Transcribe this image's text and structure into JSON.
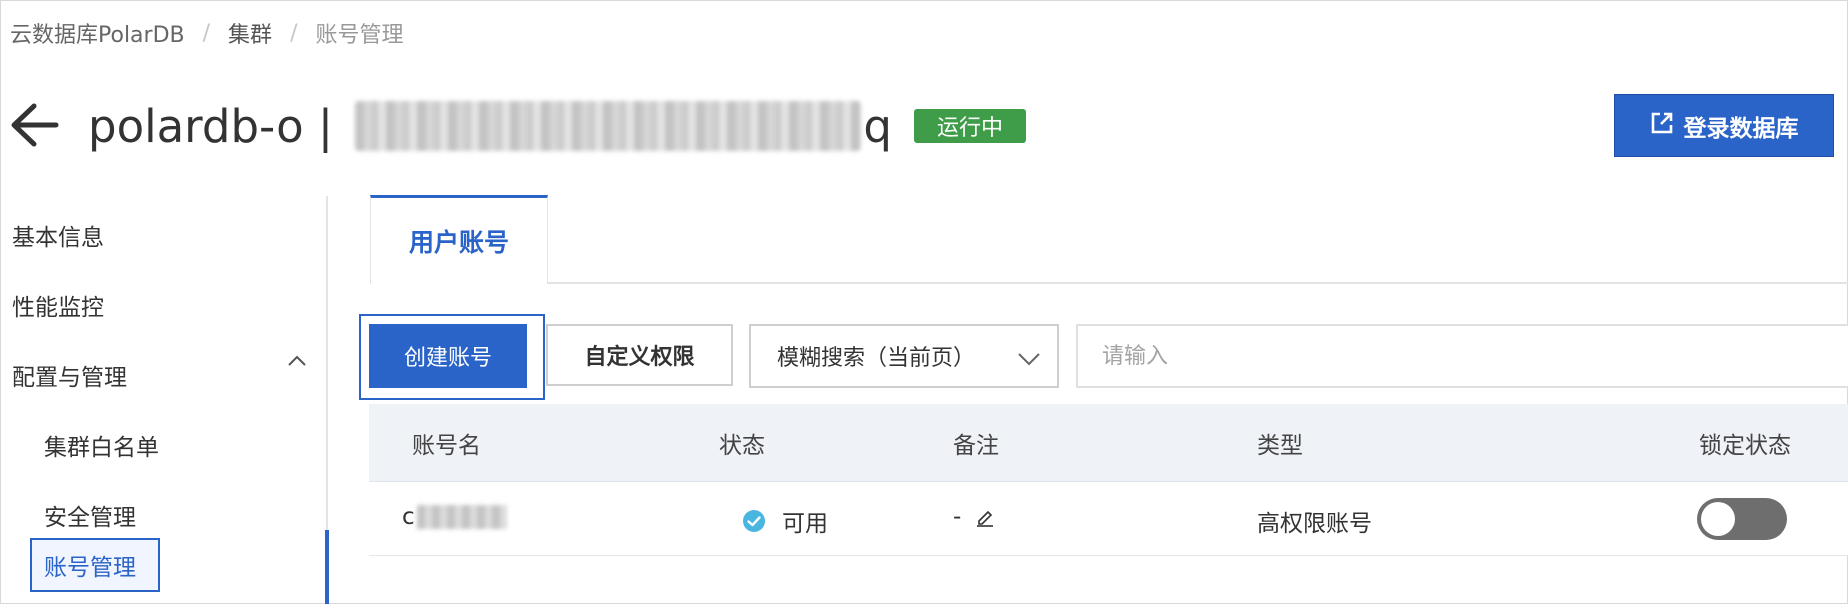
{
  "breadcrumb": {
    "items": [
      "云数据库PolarDB",
      "集群",
      "账号管理"
    ],
    "separator": "/"
  },
  "header": {
    "back_icon": "arrow-left-icon",
    "title_prefix": "polardb-o | ",
    "title_suffix": "q",
    "status": "运行中",
    "login_button": "登录数据库",
    "login_icon": "external-link-icon"
  },
  "sidebar": {
    "items": [
      "基本信息",
      "性能监控",
      "配置与管理",
      "集群白名单",
      "安全管理",
      "账号管理"
    ],
    "group_icon": "chevron-up-icon"
  },
  "tabs": {
    "active": "用户账号"
  },
  "toolbar": {
    "create_button": "创建账号",
    "permission_button": "自定义权限",
    "search_mode": "模糊搜索（当前页）",
    "search_placeholder": "请输入"
  },
  "table": {
    "columns": [
      "账号名",
      "状态",
      "备注",
      "类型",
      "锁定状态"
    ],
    "rows": [
      {
        "account_prefix": "c",
        "status": "可用",
        "remark": "-",
        "type": "高权限账号",
        "locked": false
      }
    ]
  },
  "colors": {
    "primary": "#2b64c8",
    "running": "#3f9c48",
    "status_ok": "#48b6e0"
  }
}
